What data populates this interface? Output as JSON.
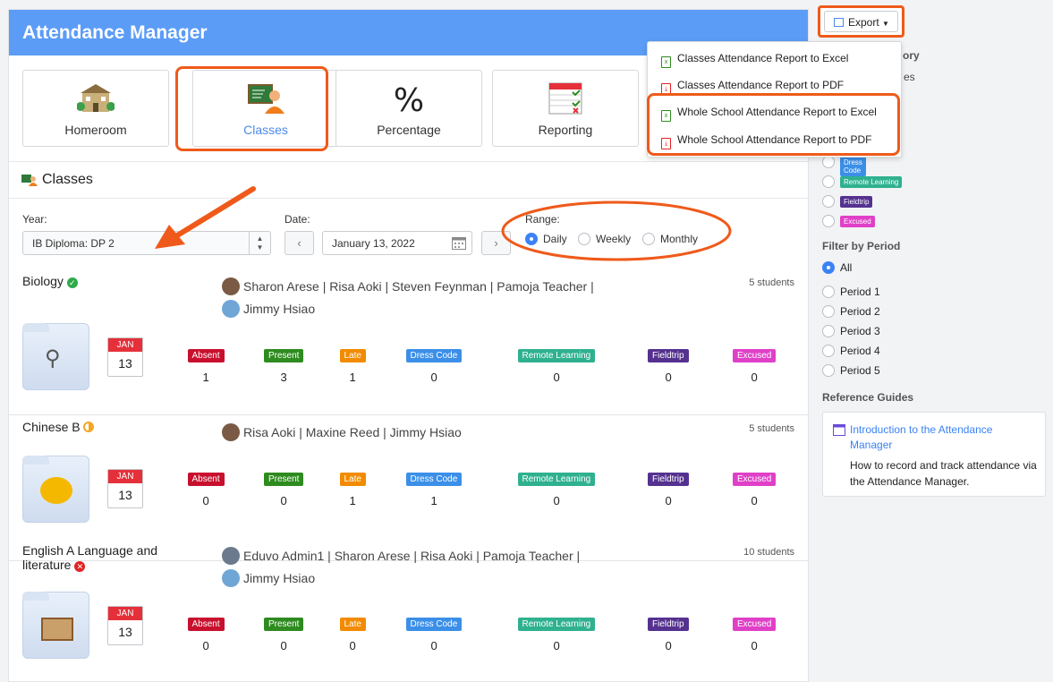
{
  "app": {
    "title": "Attendance Manager"
  },
  "tabs": [
    {
      "label": "Homeroom"
    },
    {
      "label": "Classes"
    },
    {
      "label": "Percentage"
    },
    {
      "label": "Reporting"
    }
  ],
  "section": {
    "title": "Classes"
  },
  "filters": {
    "year_label": "Year:",
    "year_value": "IB Diploma: DP 2",
    "date_label": "Date:",
    "date_value": "January 13, 2022",
    "range_label": "Range:",
    "range_options": [
      "Daily",
      "Weekly",
      "Monthly"
    ],
    "range_selected": "Daily"
  },
  "status_labels": [
    "Absent",
    "Present",
    "Late",
    "Dress Code",
    "Remote Learning",
    "Fieldtrip",
    "Excused"
  ],
  "status_colors": [
    "#c8102e",
    "#2e8b1f",
    "#f28b00",
    "#3b8fe8",
    "#2fb18f",
    "#55318f",
    "#e040c8"
  ],
  "classes": [
    {
      "name": "Biology",
      "status": "complete",
      "teachers_line1": "Sharon Arese | Risa Aoki | Steven Feynman | Pamoja Teacher |",
      "teachers_line2": "Jimmy Hsiao",
      "students": "5 students",
      "month": "JAN",
      "day": "13",
      "counts": [
        "1",
        "3",
        "1",
        "0",
        "0",
        "0",
        "0"
      ]
    },
    {
      "name": "Chinese B",
      "status": "partial",
      "teachers_line1": "Risa Aoki | Maxine Reed | Jimmy Hsiao",
      "teachers_line2": "",
      "students": "5 students",
      "month": "JAN",
      "day": "13",
      "counts": [
        "0",
        "0",
        "1",
        "1",
        "0",
        "0",
        "0"
      ]
    },
    {
      "name": "English A Language and literature",
      "status": "incomplete",
      "teachers_line1": "Eduvo Admin1 | Sharon Arese | Risa Aoki | Pamoja Teacher |",
      "teachers_line2": "Jimmy Hsiao",
      "students": "10 students",
      "month": "JAN",
      "day": "13",
      "counts": [
        "0",
        "0",
        "0",
        "0",
        "0",
        "0",
        "0"
      ]
    }
  ],
  "export": {
    "label": "Export",
    "menu": [
      "Classes Attendance Report to Excel",
      "Classes Attendance Report to PDF",
      "Whole School Attendance Report to Excel",
      "Whole School Attendance Report to PDF"
    ]
  },
  "sidebar": {
    "partial_heading": "ory",
    "partial_text": "es",
    "category_badges": [
      "Dress Code",
      "Remote Learning",
      "Fieldtrip",
      "Excused"
    ],
    "period_heading": "Filter by Period",
    "periods": [
      "All",
      "Period 1",
      "Period 2",
      "Period 3",
      "Period 4",
      "Period 5"
    ],
    "guides_heading": "Reference Guides",
    "guide_title": "Introduction to the Attendance Manager",
    "guide_desc": "How to record and track attendance via the Attendance Manager."
  }
}
